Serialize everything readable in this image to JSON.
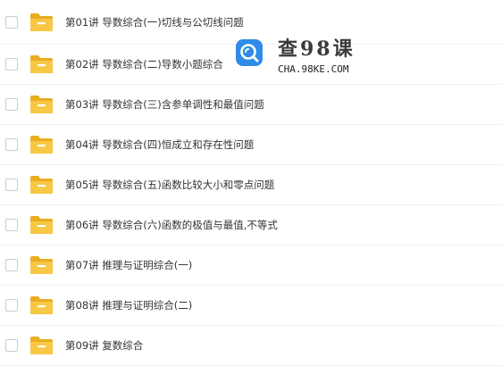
{
  "files": [
    {
      "name": "第01讲 导数综合(一)切线与公切线问题",
      "icon": "folder-icon"
    },
    {
      "name": "第02讲 导数综合(二)导数小题综合",
      "icon": "folder-icon"
    },
    {
      "name": "第03讲 导数综合(三)含参单调性和最值问题",
      "icon": "folder-icon"
    },
    {
      "name": "第04讲 导数综合(四)恒成立和存在性问题",
      "icon": "folder-icon"
    },
    {
      "name": "第05讲 导数综合(五)函数比较大小和零点问题",
      "icon": "folder-icon"
    },
    {
      "name": "第06讲 导数综合(六)函数的极值与最值,不等式",
      "icon": "folder-icon"
    },
    {
      "name": "第07讲 推理与证明综合(一)",
      "icon": "folder-icon"
    },
    {
      "name": "第08讲 推理与证明综合(二)",
      "icon": "folder-icon"
    },
    {
      "name": "第09讲 复数综合",
      "icon": "folder-icon"
    }
  ],
  "watermark": {
    "title": "查98课",
    "url": "CHA.98KE.COM"
  },
  "colors": {
    "folder": "#f7c746",
    "folder_dark": "#e9ad1f",
    "watermark_logo": "#2f8ce8",
    "divider": "#eef0f4"
  }
}
